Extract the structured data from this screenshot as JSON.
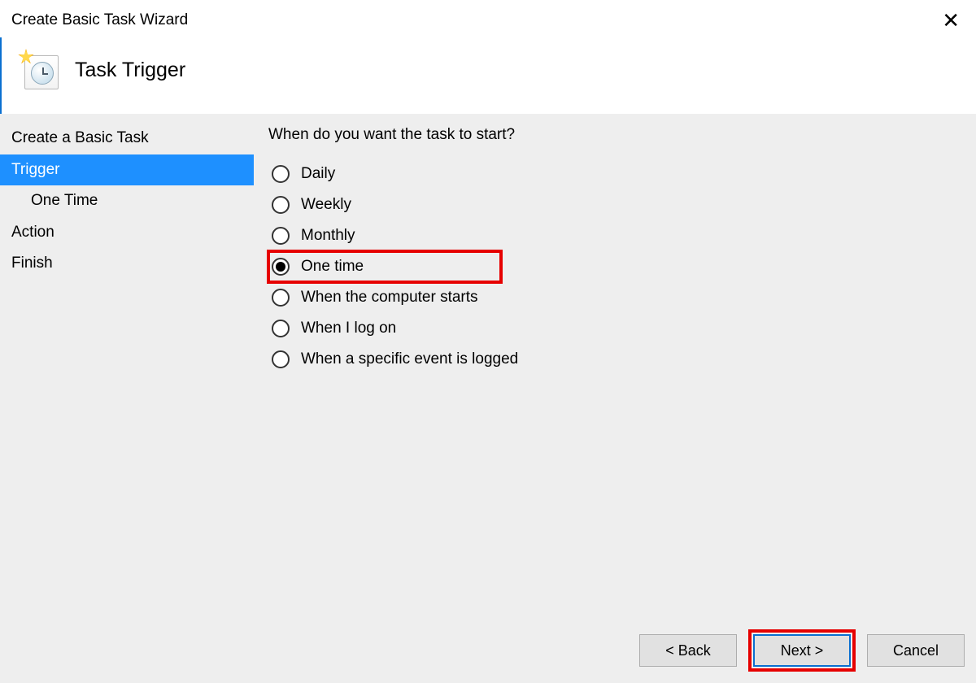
{
  "window": {
    "title": "Create Basic Task Wizard"
  },
  "header": {
    "heading": "Task Trigger"
  },
  "sidebar": {
    "items": [
      {
        "label": "Create a Basic Task",
        "selected": false,
        "sub": false
      },
      {
        "label": "Trigger",
        "selected": true,
        "sub": false
      },
      {
        "label": "One Time",
        "selected": false,
        "sub": true
      },
      {
        "label": "Action",
        "selected": false,
        "sub": false
      },
      {
        "label": "Finish",
        "selected": false,
        "sub": false
      }
    ]
  },
  "main": {
    "prompt": "When do you want the task to start?",
    "options": [
      {
        "label": "Daily",
        "checked": false,
        "highlight": false
      },
      {
        "label": "Weekly",
        "checked": false,
        "highlight": false
      },
      {
        "label": "Monthly",
        "checked": false,
        "highlight": false
      },
      {
        "label": "One time",
        "checked": true,
        "highlight": true
      },
      {
        "label": "When the computer starts",
        "checked": false,
        "highlight": false
      },
      {
        "label": "When I log on",
        "checked": false,
        "highlight": false
      },
      {
        "label": "When a specific event is logged",
        "checked": false,
        "highlight": false
      }
    ]
  },
  "footer": {
    "back": "< Back",
    "next": "Next >",
    "cancel": "Cancel",
    "next_highlight": true
  }
}
